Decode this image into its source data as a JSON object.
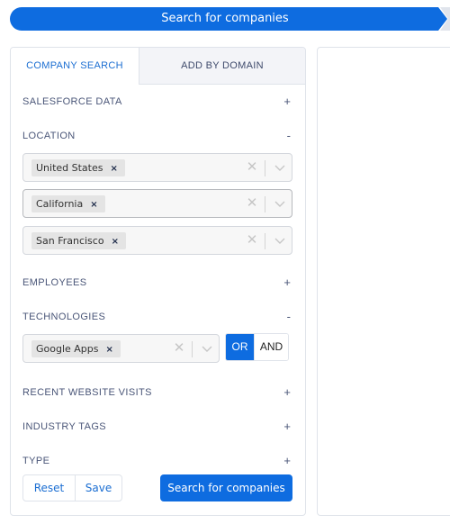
{
  "path_bar": {
    "label": "Search for companies",
    "active_color": "#0e6ce0",
    "inactive_color": "#e0e4ec"
  },
  "tabs": [
    {
      "label": "COMPANY SEARCH",
      "active": true
    },
    {
      "label": "ADD BY DOMAIN",
      "active": false
    }
  ],
  "sections": {
    "salesforce_data": {
      "label": "SALESFORCE DATA",
      "toggle": "+"
    },
    "location": {
      "label": "LOCATION",
      "toggle": "-"
    },
    "employees": {
      "label": "EMPLOYEES",
      "toggle": "+"
    },
    "technologies": {
      "label": "TECHNOLOGIES",
      "toggle": "-"
    },
    "recent_website_visits": {
      "label": "RECENT WEBSITE VISITS",
      "toggle": "+"
    },
    "industry_tags": {
      "label": "INDUSTRY TAGS",
      "toggle": "+"
    },
    "type": {
      "label": "TYPE",
      "toggle": "+"
    }
  },
  "location_filters": [
    {
      "value": "United States",
      "remove": "×"
    },
    {
      "value": "California",
      "remove": "×"
    },
    {
      "value": "San Francisco",
      "remove": "×"
    }
  ],
  "technology_filter": {
    "value": "Google Apps",
    "remove": "×"
  },
  "clear_glyph": "✕",
  "logic_toggle": {
    "options": [
      "OR",
      "AND"
    ],
    "selected": "OR"
  },
  "footer": {
    "reset_label": "Reset",
    "save_label": "Save",
    "search_label": "Search for companies"
  }
}
